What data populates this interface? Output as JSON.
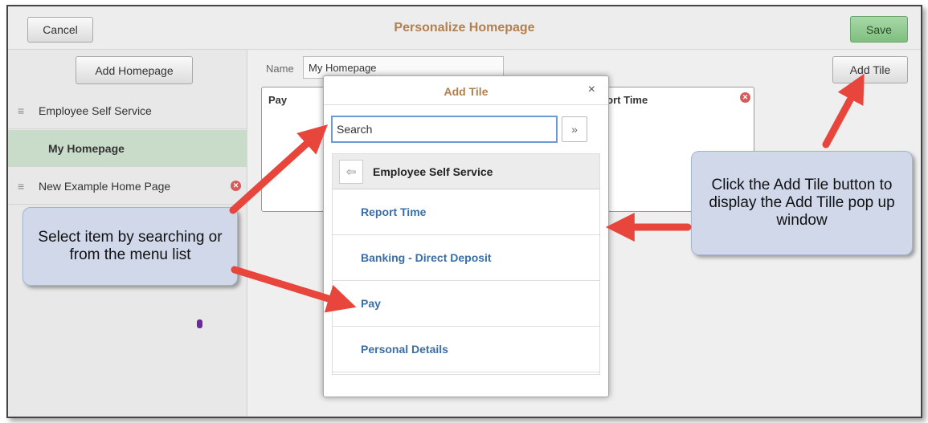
{
  "topbar": {
    "cancel_label": "Cancel",
    "title": "Personalize Homepage",
    "save_label": "Save"
  },
  "sidebar": {
    "add_homepage_label": "Add Homepage",
    "items": [
      {
        "label": "Employee Self Service",
        "active": false,
        "removable": false
      },
      {
        "label": "My Homepage",
        "active": true,
        "removable": false
      },
      {
        "label": "New  Example Home Page",
        "active": false,
        "removable": true
      }
    ]
  },
  "main": {
    "name_label": "Name",
    "name_value": "My Homepage",
    "add_tile_label": "Add Tile",
    "tiles": [
      {
        "title": "Pay"
      },
      {
        "title": "eport Time"
      }
    ]
  },
  "modal": {
    "title": "Add Tile",
    "close_glyph": "×",
    "search_value": "Search",
    "search_go_glyph": "»",
    "back_glyph": "⇦",
    "category": "Employee Self Service",
    "items": [
      "Report Time",
      "Banking - Direct Deposit",
      "Pay",
      "Personal Details"
    ]
  },
  "callouts": {
    "left": "Select item by searching or from the menu list",
    "right": "Click the Add Tile button to display the Add Tille pop up window"
  },
  "icons": {
    "grip": "≡",
    "remove": "✕"
  },
  "colors": {
    "title_accent": "#b08050",
    "link_blue": "#3a6ea5",
    "save_green": "#7fbf7f",
    "arrow_red": "#e8463c",
    "callout_bg": "#d0d8ea",
    "active_row": "#c9dcc9"
  }
}
